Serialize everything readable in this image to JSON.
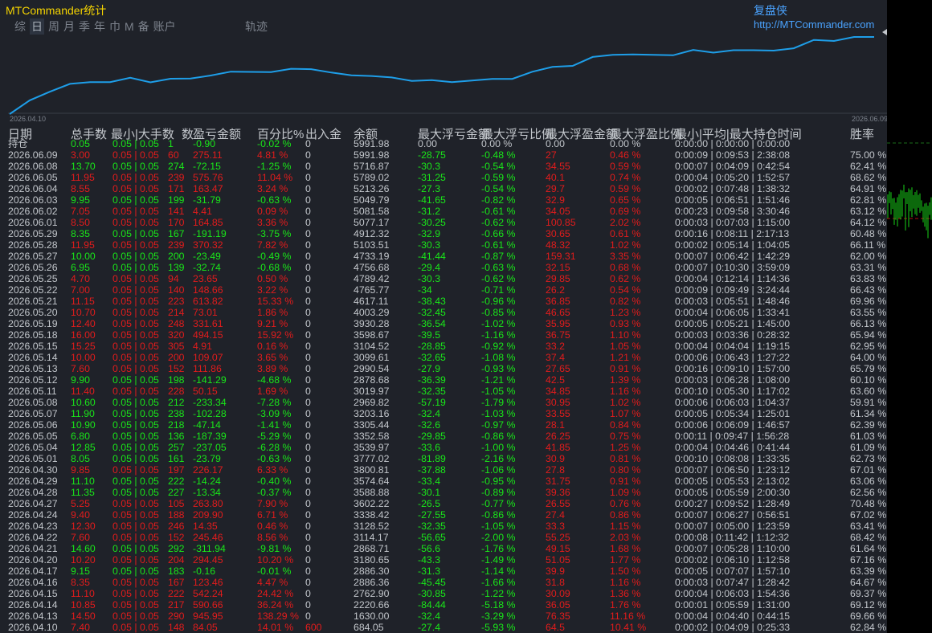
{
  "app_title": "MTCommander统计",
  "brand": {
    "cn": "复盘侠",
    "url": "http://MTCommander.com"
  },
  "tabs": [
    "综",
    "日",
    "周",
    "月",
    "季",
    "年",
    "巾",
    "M",
    "备",
    "账户"
  ],
  "active_tab": "日",
  "trace_label": "轨迹",
  "equity_chart": {
    "type": "line",
    "x_start": "2026.04.10",
    "x_end": "2026.06.09",
    "line_color": "#1e9ee8",
    "values": [
      684.05,
      1630.0,
      2220.66,
      2762.9,
      2886.36,
      2886.3,
      3180.65,
      2868.71,
      3114.17,
      3128.52,
      3338.42,
      3602.22,
      3588.88,
      3574.64,
      3800.81,
      3777.02,
      3539.97,
      3352.58,
      3305.44,
      3203.16,
      2969.82,
      3019.97,
      2878.68,
      2990.54,
      3099.61,
      3104.52,
      3598.67,
      3930.28,
      4003.29,
      4617.11,
      4765.77,
      4789.42,
      4756.68,
      4733.19,
      5103.51,
      4912.32,
      5077.17,
      5081.58,
      5049.79,
      5213.26,
      5789.02,
      5716.87,
      5991.98,
      5991.98
    ]
  },
  "headers": [
    "日期",
    "总手数",
    "最小|大手数",
    "数",
    "盈亏金额",
    "百分比%",
    "出入金",
    "余额",
    "最大浮亏金额",
    "最大浮亏比例",
    "最大浮盈金额",
    "最大浮盈比例",
    "最小|平均|最大持仓时间",
    "胜率"
  ],
  "holding_label": "持仓",
  "holding_row": {
    "lots": "0.05",
    "minmax": "0.05 | 0.05",
    "n": "1",
    "pl": "-0.90",
    "pct": "-0.02 %",
    "io": "0",
    "bal": "5991.98",
    "mfl": "0.00",
    "mflp": "0.00 %",
    "mfp": "0.00",
    "mfpp": "0.00 %",
    "time": "0:00:00 | 0:00:00 | 0:00:00"
  },
  "rows": [
    {
      "date": "2026.06.09",
      "lots": "3.00",
      "n": "60",
      "pl": "275.11",
      "pct": "4.81 %",
      "bal": "5991.98",
      "mfl": "-28.75",
      "mflp": "-0.48 %",
      "mfp": "27",
      "mfpp": "0.46 %",
      "time": "0:00:09 | 0:09:53 | 2:38:08",
      "win": "75.00 %"
    },
    {
      "date": "2026.06.08",
      "lots": "13.70",
      "n": "274",
      "pl": "-72.15",
      "pct": "-1.25 %",
      "bal": "5716.87",
      "mfl": "-30.3",
      "mflp": "-0.54 %",
      "mfp": "34.55",
      "mfpp": "0.59 %",
      "time": "0:00:07 | 0:04:09 | 0:42:54",
      "win": "62.41 %"
    },
    {
      "date": "2026.06.05",
      "lots": "11.95",
      "n": "239",
      "pl": "575.76",
      "pct": "11.04 %",
      "bal": "5789.02",
      "mfl": "-31.25",
      "mflp": "-0.59 %",
      "mfp": "40.1",
      "mfpp": "0.74 %",
      "time": "0:00:04 | 0:05:20 | 1:52:57",
      "win": "68.62 %"
    },
    {
      "date": "2026.06.04",
      "lots": "8.55",
      "n": "171",
      "pl": "163.47",
      "pct": "3.24 %",
      "bal": "5213.26",
      "mfl": "-27.3",
      "mflp": "-0.54 %",
      "mfp": "29.7",
      "mfpp": "0.59 %",
      "time": "0:00:02 | 0:07:48 | 1:38:32",
      "win": "64.91 %"
    },
    {
      "date": "2026.06.03",
      "lots": "9.95",
      "n": "199",
      "pl": "-31.79",
      "pct": "-0.63 %",
      "bal": "5049.79",
      "mfl": "-41.65",
      "mflp": "-0.82 %",
      "mfp": "32.9",
      "mfpp": "0.65 %",
      "time": "0:00:05 | 0:06:51 | 1:51:46",
      "win": "62.81 %"
    },
    {
      "date": "2026.06.02",
      "lots": "7.05",
      "n": "141",
      "pl": "4.41",
      "pct": "0.09 %",
      "bal": "5081.58",
      "mfl": "-31.2",
      "mflp": "-0.61 %",
      "mfp": "34.05",
      "mfpp": "0.69 %",
      "time": "0:00:23 | 0:09:58 | 3:30:46",
      "win": "63.12 %"
    },
    {
      "date": "2026.06.01",
      "lots": "8.50",
      "n": "170",
      "pl": "164.85",
      "pct": "3.36 %",
      "bal": "5077.17",
      "mfl": "-30.25",
      "mflp": "-0.62 %",
      "mfp": "100.85",
      "mfpp": "2.02 %",
      "time": "0:00:03 | 0:07:03 | 1:15:00",
      "win": "64.12 %"
    },
    {
      "date": "2026.05.29",
      "lots": "8.35",
      "n": "167",
      "pl": "-191.19",
      "pct": "-3.75 %",
      "bal": "4912.32",
      "mfl": "-32.9",
      "mflp": "-0.66 %",
      "mfp": "30.65",
      "mfpp": "0.61 %",
      "time": "0:00:16 | 0:08:11 | 2:17:13",
      "win": "60.48 %"
    },
    {
      "date": "2026.05.28",
      "lots": "11.95",
      "n": "239",
      "pl": "370.32",
      "pct": "7.82 %",
      "bal": "5103.51",
      "mfl": "-30.3",
      "mflp": "-0.61 %",
      "mfp": "48.32",
      "mfpp": "1.02 %",
      "time": "0:00:02 | 0:05:14 | 1:04:05",
      "win": "66.11 %"
    },
    {
      "date": "2026.05.27",
      "lots": "10.00",
      "n": "200",
      "pl": "-23.49",
      "pct": "-0.49 %",
      "bal": "4733.19",
      "mfl": "-41.44",
      "mflp": "-0.87 %",
      "mfp": "159.31",
      "mfpp": "3.35 %",
      "time": "0:00:07 | 0:06:42 | 1:42:29",
      "win": "62.00 %"
    },
    {
      "date": "2026.05.26",
      "lots": "6.95",
      "n": "139",
      "pl": "-32.74",
      "pct": "-0.68 %",
      "bal": "4756.68",
      "mfl": "-29.4",
      "mflp": "-0.63 %",
      "mfp": "32.15",
      "mfpp": "0.68 %",
      "time": "0:00:07 | 0:10:30 | 3:59:09",
      "win": "63.31 %"
    },
    {
      "date": "2026.05.25",
      "lots": "4.70",
      "n": "94",
      "pl": "23.65",
      "pct": "0.50 %",
      "bal": "4789.42",
      "mfl": "-30.3",
      "mflp": "-0.62 %",
      "mfp": "29.85",
      "mfpp": "0.62 %",
      "time": "0:00:04 | 0:12:14 | 1:14:36",
      "win": "63.83 %"
    },
    {
      "date": "2026.05.22",
      "lots": "7.00",
      "n": "140",
      "pl": "148.66",
      "pct": "3.22 %",
      "bal": "4765.77",
      "mfl": "-34",
      "mflp": "-0.71 %",
      "mfp": "26.2",
      "mfpp": "0.54 %",
      "time": "0:00:09 | 0:09:49 | 3:24:44",
      "win": "66.43 %"
    },
    {
      "date": "2026.05.21",
      "lots": "11.15",
      "n": "223",
      "pl": "613.82",
      "pct": "15.33 %",
      "bal": "4617.11",
      "mfl": "-38.43",
      "mflp": "-0.96 %",
      "mfp": "36.85",
      "mfpp": "0.82 %",
      "time": "0:00:03 | 0:05:51 | 1:48:46",
      "win": "69.96 %"
    },
    {
      "date": "2026.05.20",
      "lots": "10.70",
      "n": "214",
      "pl": "73.01",
      "pct": "1.86 %",
      "bal": "4003.29",
      "mfl": "-32.45",
      "mflp": "-0.85 %",
      "mfp": "46.65",
      "mfpp": "1.23 %",
      "time": "0:00:04 | 0:06:05 | 1:33:41",
      "win": "63.55 %"
    },
    {
      "date": "2026.05.19",
      "lots": "12.40",
      "n": "248",
      "pl": "331.61",
      "pct": "9.21 %",
      "bal": "3930.28",
      "mfl": "-36.54",
      "mflp": "-1.02 %",
      "mfp": "35.95",
      "mfpp": "0.93 %",
      "time": "0:00:05 | 0:05:21 | 1:45:00",
      "win": "66.13 %"
    },
    {
      "date": "2026.05.18",
      "lots": "16.00",
      "n": "320",
      "pl": "494.15",
      "pct": "15.92 %",
      "bal": "3598.67",
      "mfl": "-39.5",
      "mflp": "-1.16 %",
      "mfp": "36.75",
      "mfpp": "1.10 %",
      "time": "0:00:03 | 0:03:36 | 0:28:32",
      "win": "65.94 %"
    },
    {
      "date": "2026.05.15",
      "lots": "15.25",
      "n": "305",
      "pl": "4.91",
      "pct": "0.16 %",
      "bal": "3104.52",
      "mfl": "-28.85",
      "mflp": "-0.92 %",
      "mfp": "33.2",
      "mfpp": "1.05 %",
      "time": "0:00:04 | 0:04:04 | 1:19:15",
      "win": "62.95 %"
    },
    {
      "date": "2026.05.14",
      "lots": "10.00",
      "n": "200",
      "pl": "109.07",
      "pct": "3.65 %",
      "bal": "3099.61",
      "mfl": "-32.65",
      "mflp": "-1.08 %",
      "mfp": "37.4",
      "mfpp": "1.21 %",
      "time": "0:00:06 | 0:06:43 | 1:27:22",
      "win": "64.00 %"
    },
    {
      "date": "2026.05.13",
      "lots": "7.60",
      "n": "152",
      "pl": "111.86",
      "pct": "3.89 %",
      "bal": "2990.54",
      "mfl": "-27.9",
      "mflp": "-0.93 %",
      "mfp": "27.65",
      "mfpp": "0.91 %",
      "time": "0:00:16 | 0:09:10 | 1:57:00",
      "win": "65.79 %"
    },
    {
      "date": "2026.05.12",
      "lots": "9.90",
      "n": "198",
      "pl": "-141.29",
      "pct": "-4.68 %",
      "bal": "2878.68",
      "mfl": "-36.39",
      "mflp": "-1.21 %",
      "mfp": "42.5",
      "mfpp": "1.39 %",
      "time": "0:00:03 | 0:06:28 | 1:08:00",
      "win": "60.10 %"
    },
    {
      "date": "2026.05.11",
      "lots": "11.40",
      "n": "228",
      "pl": "50.15",
      "pct": "1.69 %",
      "bal": "3019.97",
      "mfl": "-32.35",
      "mflp": "-1.05 %",
      "mfp": "34.85",
      "mfpp": "1.16 %",
      "time": "0:00:10 | 0:05:30 | 1:17:02",
      "win": "63.60 %"
    },
    {
      "date": "2026.05.08",
      "lots": "10.60",
      "n": "212",
      "pl": "-233.34",
      "pct": "-7.28 %",
      "bal": "2969.82",
      "mfl": "-57.19",
      "mflp": "-1.79 %",
      "mfp": "30.95",
      "mfpp": "1.02 %",
      "time": "0:00:06 | 0:06:03 | 1:04:37",
      "win": "59.91 %"
    },
    {
      "date": "2026.05.07",
      "lots": "11.90",
      "n": "238",
      "pl": "-102.28",
      "pct": "-3.09 %",
      "bal": "3203.16",
      "mfl": "-32.4",
      "mflp": "-1.03 %",
      "mfp": "33.55",
      "mfpp": "1.07 %",
      "time": "0:00:05 | 0:05:34 | 1:25:01",
      "win": "61.34 %"
    },
    {
      "date": "2026.05.06",
      "lots": "10.90",
      "n": "218",
      "pl": "-47.14",
      "pct": "-1.41 %",
      "bal": "3305.44",
      "mfl": "-32.6",
      "mflp": "-0.97 %",
      "mfp": "28.1",
      "mfpp": "0.84 %",
      "time": "0:00:06 | 0:06:09 | 1:46:57",
      "win": "62.39 %"
    },
    {
      "date": "2026.05.05",
      "lots": "6.80",
      "n": "136",
      "pl": "-187.39",
      "pct": "-5.29 %",
      "bal": "3352.58",
      "mfl": "-29.85",
      "mflp": "-0.86 %",
      "mfp": "26.25",
      "mfpp": "0.75 %",
      "time": "0:00:11 | 0:09:47 | 1:56:28",
      "win": "61.03 %"
    },
    {
      "date": "2026.05.04",
      "lots": "12.85",
      "n": "257",
      "pl": "-237.05",
      "pct": "-6.28 %",
      "bal": "3539.97",
      "mfl": "-33.6",
      "mflp": "-1.00 %",
      "mfp": "41.85",
      "mfpp": "1.25 %",
      "time": "0:00:04 | 0:04:46 | 0:41:44",
      "win": "61.09 %"
    },
    {
      "date": "2026.05.01",
      "lots": "8.05",
      "n": "161",
      "pl": "-23.79",
      "pct": "-0.63 %",
      "bal": "3777.02",
      "mfl": "-81.89",
      "mflp": "-2.16 %",
      "mfp": "30.9",
      "mfpp": "0.81 %",
      "time": "0:00:10 | 0:08:08 | 1:33:35",
      "win": "62.73 %"
    },
    {
      "date": "2026.04.30",
      "lots": "9.85",
      "n": "197",
      "pl": "226.17",
      "pct": "6.33 %",
      "bal": "3800.81",
      "mfl": "-37.88",
      "mflp": "-1.06 %",
      "mfp": "27.8",
      "mfpp": "0.80 %",
      "time": "0:00:07 | 0:06:50 | 1:23:12",
      "win": "67.01 %"
    },
    {
      "date": "2026.04.29",
      "lots": "11.10",
      "n": "222",
      "pl": "-14.24",
      "pct": "-0.40 %",
      "bal": "3574.64",
      "mfl": "-33.4",
      "mflp": "-0.95 %",
      "mfp": "31.75",
      "mfpp": "0.91 %",
      "time": "0:00:05 | 0:05:53 | 2:13:02",
      "win": "63.06 %"
    },
    {
      "date": "2026.04.28",
      "lots": "11.35",
      "n": "227",
      "pl": "-13.34",
      "pct": "-0.37 %",
      "bal": "3588.88",
      "mfl": "-30.1",
      "mflp": "-0.89 %",
      "mfp": "39.36",
      "mfpp": "1.09 %",
      "time": "0:00:05 | 0:05:59 | 2:00:30",
      "win": "62.56 %"
    },
    {
      "date": "2026.04.27",
      "lots": "5.25",
      "n": "105",
      "pl": "263.80",
      "pct": "7.90 %",
      "bal": "3602.22",
      "mfl": "-26.5",
      "mflp": "-0.77 %",
      "mfp": "26.55",
      "mfpp": "0.76 %",
      "time": "0:00:27 | 0:09:52 | 1:28:49",
      "win": "70.48 %"
    },
    {
      "date": "2026.04.24",
      "lots": "9.40",
      "n": "188",
      "pl": "209.90",
      "pct": "6.71 %",
      "bal": "3338.42",
      "mfl": "-27.55",
      "mflp": "-0.86 %",
      "mfp": "27.4",
      "mfpp": "0.86 %",
      "time": "0:00:07 | 0:06:27 | 0:56:51",
      "win": "67.02 %"
    },
    {
      "date": "2026.04.23",
      "lots": "12.30",
      "n": "246",
      "pl": "14.35",
      "pct": "0.46 %",
      "bal": "3128.52",
      "mfl": "-32.35",
      "mflp": "-1.05 %",
      "mfp": "33.3",
      "mfpp": "1.15 %",
      "time": "0:00:07 | 0:05:00 | 1:23:59",
      "win": "63.41 %"
    },
    {
      "date": "2026.04.22",
      "lots": "7.60",
      "n": "152",
      "pl": "245.46",
      "pct": "8.56 %",
      "bal": "3114.17",
      "mfl": "-56.65",
      "mflp": "-2.00 %",
      "mfp": "55.25",
      "mfpp": "2.03 %",
      "time": "0:00:08 | 0:11:42 | 1:12:32",
      "win": "68.42 %"
    },
    {
      "date": "2026.04.21",
      "lots": "14.60",
      "n": "292",
      "pl": "-311.94",
      "pct": "-9.81 %",
      "bal": "2868.71",
      "mfl": "-56.6",
      "mflp": "-1.76 %",
      "mfp": "49.15",
      "mfpp": "1.68 %",
      "time": "0:00:07 | 0:05:28 | 1:10:00",
      "win": "61.64 %"
    },
    {
      "date": "2026.04.20",
      "lots": "10.20",
      "n": "204",
      "pl": "294.45",
      "pct": "10.20 %",
      "bal": "3180.65",
      "mfl": "-43.3",
      "mflp": "-1.49 %",
      "mfp": "51.05",
      "mfpp": "1.77 %",
      "time": "0:00:02 | 0:06:10 | 1:12:58",
      "win": "67.16 %"
    },
    {
      "date": "2026.04.17",
      "lots": "9.15",
      "n": "183",
      "pl": "-0.16",
      "pct": "-0.01 %",
      "bal": "2886.30",
      "mfl": "-31.3",
      "mflp": "-1.14 %",
      "mfp": "39.9",
      "mfpp": "1.50 %",
      "time": "0:00:05 | 0:07:07 | 1:57:10",
      "win": "63.39 %"
    },
    {
      "date": "2026.04.16",
      "lots": "8.35",
      "n": "167",
      "pl": "123.46",
      "pct": "4.47 %",
      "bal": "2886.36",
      "mfl": "-45.45",
      "mflp": "-1.66 %",
      "mfp": "31.8",
      "mfpp": "1.16 %",
      "time": "0:00:03 | 0:07:47 | 1:28:42",
      "win": "64.67 %"
    },
    {
      "date": "2026.04.15",
      "lots": "11.10",
      "n": "222",
      "pl": "542.24",
      "pct": "24.42 %",
      "bal": "2762.90",
      "mfl": "-30.85",
      "mflp": "-1.22 %",
      "mfp": "30.09",
      "mfpp": "1.36 %",
      "time": "0:00:04 | 0:06:03 | 1:54:36",
      "win": "69.37 %"
    },
    {
      "date": "2026.04.14",
      "lots": "10.85",
      "n": "217",
      "pl": "590.66",
      "pct": "36.24 %",
      "bal": "2220.66",
      "mfl": "-84.44",
      "mflp": "-5.18 %",
      "mfp": "36.05",
      "mfpp": "1.76 %",
      "time": "0:00:01 | 0:05:59 | 1:31:00",
      "win": "69.12 %"
    },
    {
      "date": "2026.04.13",
      "lots": "14.50",
      "n": "290",
      "pl": "945.95",
      "pct": "138.29 %",
      "bal": "1630.00",
      "mfl": "-32.4",
      "mflp": "-3.29 %",
      "mfp": "76.35",
      "mfpp": "11.16 %",
      "time": "0:00:04 | 0:04:40 | 0:44:15",
      "win": "69.66 %"
    },
    {
      "date": "2026.04.10",
      "lots": "7.40",
      "n": "148",
      "pl": "84.05",
      "pct": "14.01 %",
      "io": "600",
      "bal": "684.05",
      "mfl": "-27.4",
      "mflp": "-5.93 %",
      "mfp": "64.5",
      "mfpp": "10.41 %",
      "time": "0:00:02 | 0:04:09 | 0:25:33",
      "win": "62.84 %"
    }
  ],
  "minmax_default": "0.05 | 0.05",
  "io_default": "0",
  "colors": {
    "bg": "#1f2229",
    "text": "#c3c7cc",
    "profit": "#e21c1c",
    "loss": "#19e619",
    "title": "#f5d400",
    "link": "#4aa3ff"
  }
}
